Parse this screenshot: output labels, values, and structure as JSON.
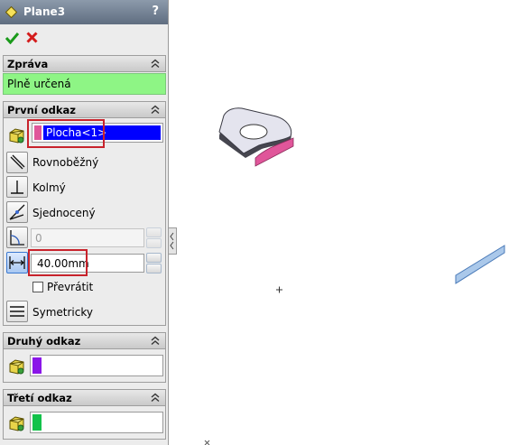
{
  "panel": {
    "title": "Plane3",
    "help": "?"
  },
  "message": {
    "header": "Zpráva",
    "text": "Plně určená"
  },
  "first_reference": {
    "header": "První odkaz",
    "selection": "Plocha<1>",
    "options": {
      "parallel": "Rovnoběžný",
      "perpendicular": "Kolmý",
      "coincident": "Sjednocený"
    },
    "angle_value": "0",
    "distance_value": "40.00mm",
    "flip_label": "Převrátit",
    "symmetric_label": "Symetricky"
  },
  "second_reference": {
    "header": "Druhý odkaz",
    "color": "#8a16e8"
  },
  "third_reference": {
    "header": "Třetí odkaz",
    "color": "#12c24a"
  },
  "colors": {
    "selection_highlight": "#0000ff",
    "message_bg": "#8ef585",
    "callout": "#c8232c",
    "selected_face": "#e0569a"
  }
}
